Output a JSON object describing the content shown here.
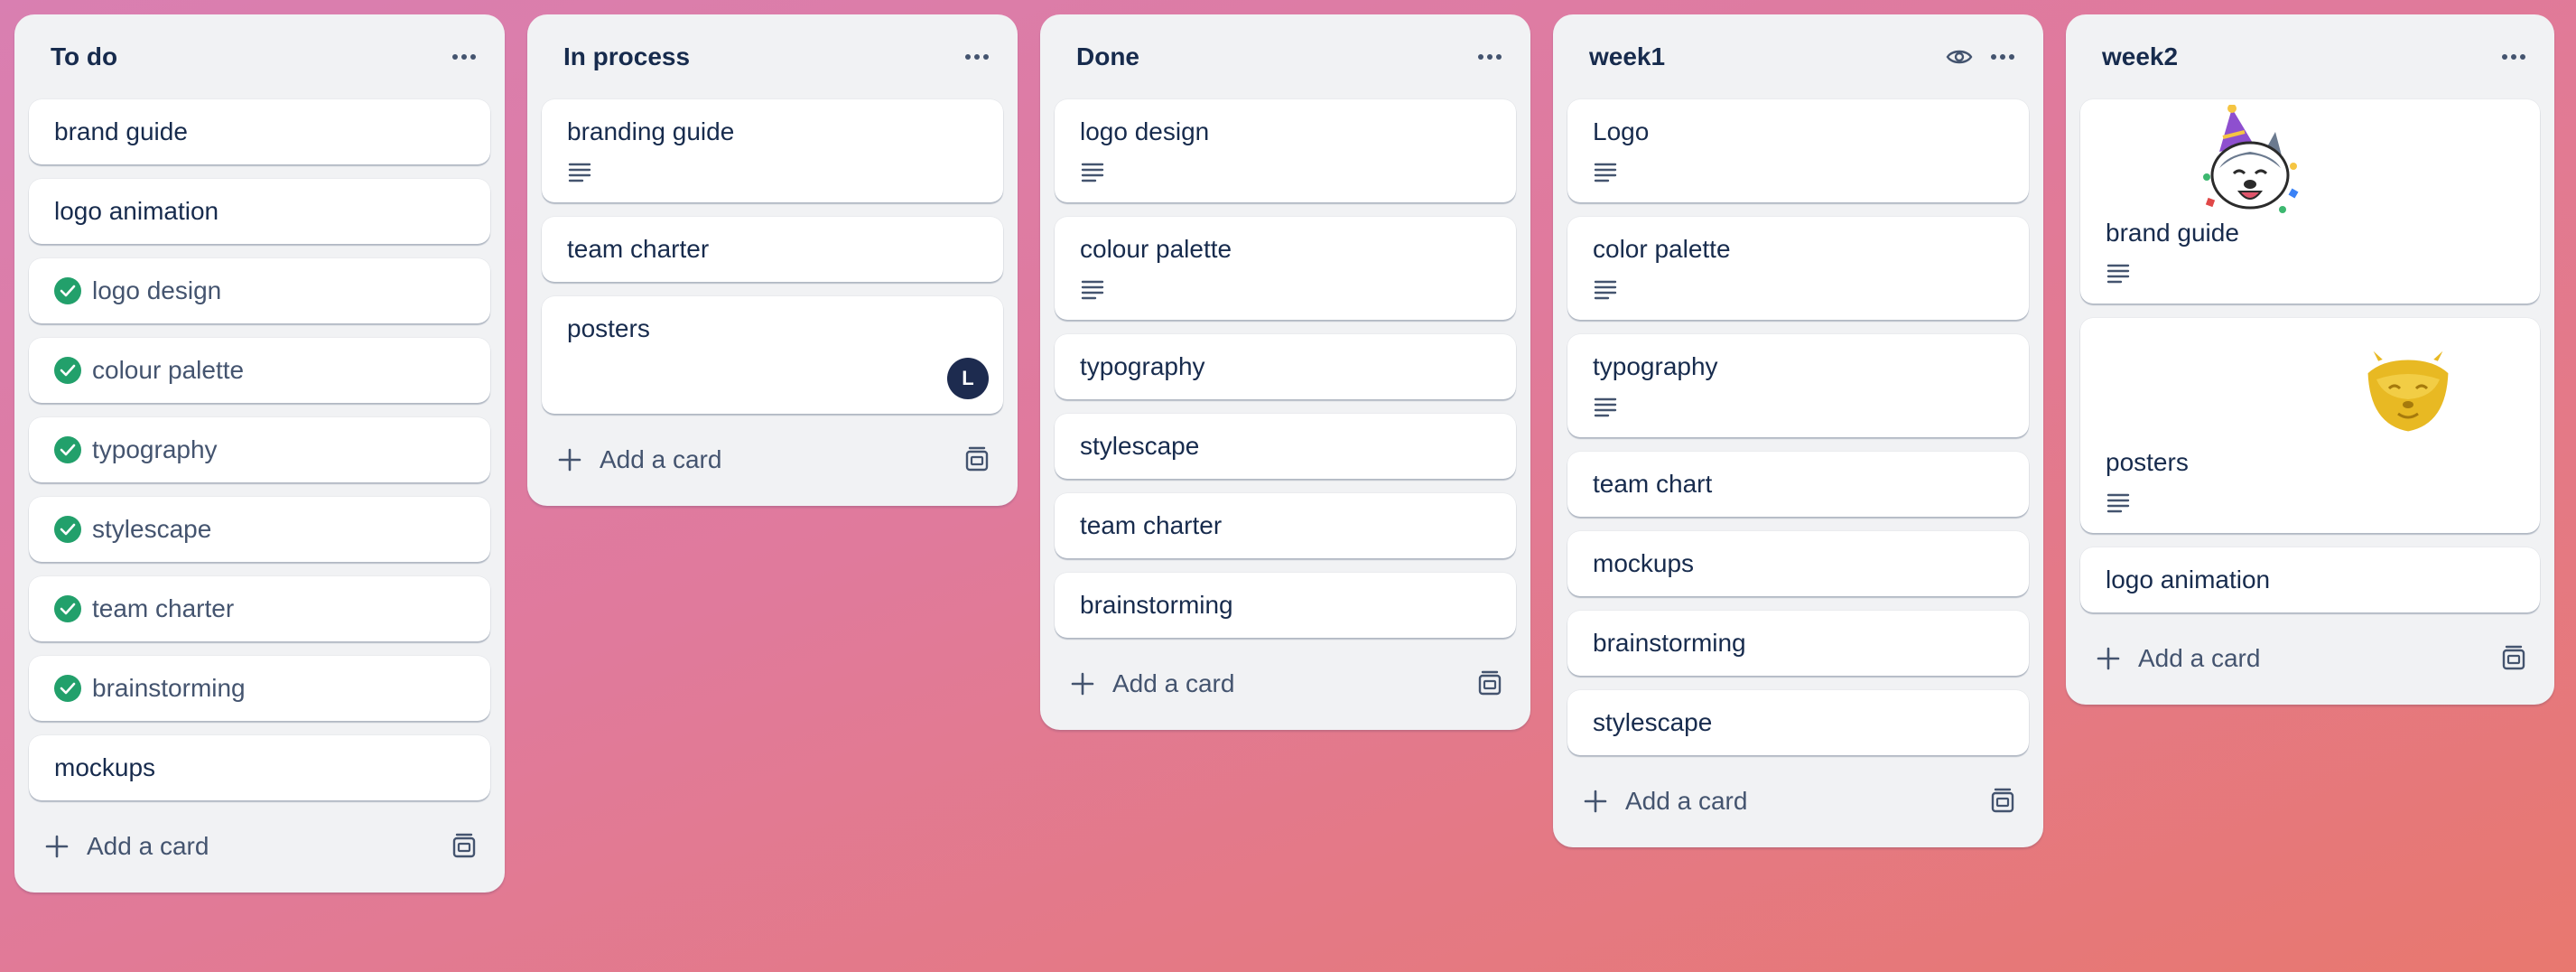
{
  "lists": [
    {
      "title": "To do",
      "add_label": "Add a card",
      "cards": [
        {
          "title": "brand guide"
        },
        {
          "title": "logo animation"
        },
        {
          "title": "logo design",
          "complete": true
        },
        {
          "title": "colour palette",
          "complete": true
        },
        {
          "title": "typography",
          "complete": true
        },
        {
          "title": "stylescape",
          "complete": true
        },
        {
          "title": "team charter",
          "complete": true
        },
        {
          "title": "brainstorming",
          "complete": true
        },
        {
          "title": "mockups"
        }
      ]
    },
    {
      "title": "In process",
      "add_label": "Add a card",
      "cards": [
        {
          "title": "branding guide",
          "has_description": true
        },
        {
          "title": "team charter"
        },
        {
          "title": "posters",
          "member_initial": "L"
        }
      ]
    },
    {
      "title": "Done",
      "add_label": "Add a card",
      "cards": [
        {
          "title": "logo design",
          "has_description": true
        },
        {
          "title": "colour palette",
          "has_description": true
        },
        {
          "title": "typography"
        },
        {
          "title": "stylescape"
        },
        {
          "title": "team charter"
        },
        {
          "title": "brainstorming"
        }
      ]
    },
    {
      "title": "week1",
      "add_label": "Add a card",
      "watching": true,
      "cards": [
        {
          "title": "Logo",
          "has_description": true
        },
        {
          "title": "color palette",
          "has_description": true
        },
        {
          "title": "typography",
          "has_description": true
        },
        {
          "title": "team chart"
        },
        {
          "title": "mockups"
        },
        {
          "title": "brainstorming"
        },
        {
          "title": "stylescape"
        }
      ]
    },
    {
      "title": "week2",
      "add_label": "Add a card",
      "cards": [
        {
          "title": "brand guide",
          "has_description": true,
          "sticker": "party-husky-sticker"
        },
        {
          "title": "posters",
          "has_description": true,
          "sticker": "gold-fox-sticker"
        },
        {
          "title": "logo animation"
        }
      ]
    }
  ],
  "colors": {
    "check_green": "#22a06b",
    "list_bg": "#f1f2f4",
    "avatar_bg": "#1d2b4f"
  }
}
